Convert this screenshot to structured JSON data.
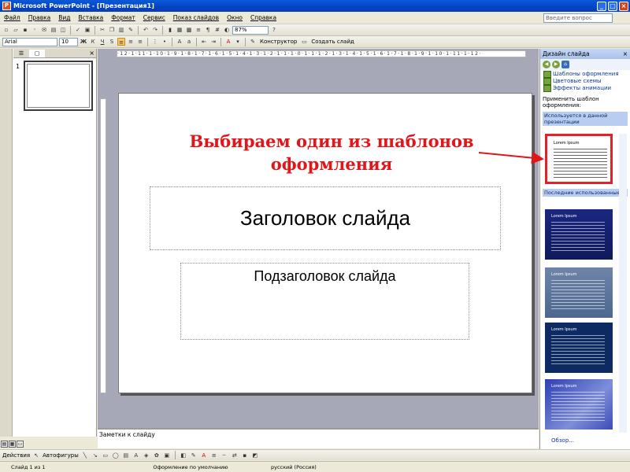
{
  "window": {
    "app_icon": "P",
    "title": "Microsoft PowerPoint - [Презентация1]",
    "controls": [
      "_",
      "□",
      "×"
    ]
  },
  "menu": {
    "items": [
      "Файл",
      "Правка",
      "Вид",
      "Вставка",
      "Формат",
      "Сервис",
      "Показ слайдов",
      "Окно",
      "Справка"
    ],
    "ask_placeholder": "Введите вопрос"
  },
  "toolbar": {
    "zoom": "87%",
    "font": "Arial",
    "size": "10",
    "bold": "Ж",
    "italic": "К",
    "underline": "Ч",
    "shadow": "S",
    "designer_label": "Конструктор",
    "new_slide_label": "Создать слайд"
  },
  "left_pane": {
    "slide_number": "1",
    "close": "×"
  },
  "ruler": {
    "horizontal": "·12·1·11·1·10·1·9·1·8·1·7·1·6·1·5·1·4·1·3·1·2·1·1·1·0·1·1·1·2·1·3·1·4·1·5·1·6·1·7·1·8·1·9·1·10·1·11·1·12·"
  },
  "slide": {
    "annotation": "Выбираем один из шаблонов оформления",
    "title_placeholder": "Заголовок слайда",
    "subtitle_placeholder": "Подзаголовок слайда"
  },
  "notes": {
    "placeholder": "Заметки к слайду"
  },
  "task_pane": {
    "title": "Дизайн слайда",
    "close": "×",
    "links": [
      "Шаблоны оформления",
      "Цветовые схемы",
      "Эффекты анимации"
    ],
    "apply_label": "Применить шаблон оформления:",
    "group_used": "Используется в данной презентации",
    "group_recent": "Последние использованные",
    "template_caption": "Lorem Ipsum",
    "browse": "Обзор..."
  },
  "drawing_toolbar": {
    "actions": "Действия",
    "autoshapes": "Автофигуры"
  },
  "status": {
    "slide": "Слайд 1 из 1",
    "design": "Оформление по умолчанию",
    "language": "русский (Россия)"
  },
  "colors": {
    "annotation": "#e1161a",
    "highlight_border": "#e0222a",
    "titlebar": "#0343c4"
  }
}
